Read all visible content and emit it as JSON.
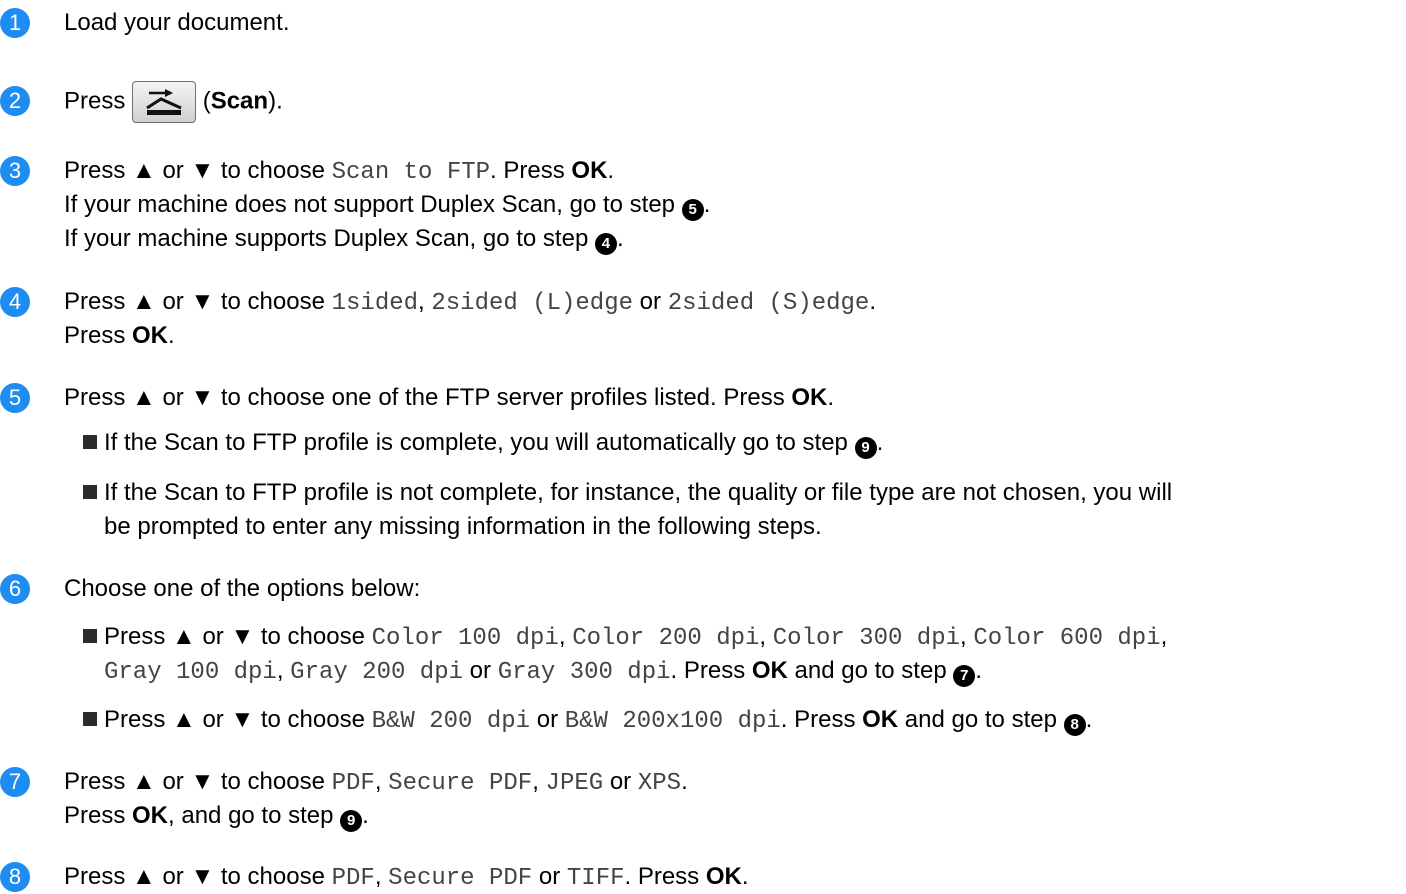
{
  "steps": [
    {
      "num": "1",
      "lines": [
        "Load your document."
      ]
    },
    {
      "num": "2",
      "press": "Press",
      "paren_open": "(",
      "scan_label": "Scan",
      "paren_close": ")."
    },
    {
      "num": "3",
      "a": "Press ▲ or ▼ to choose ",
      "mono": "Scan to FTP",
      "b": ". Press ",
      "ok": "OK",
      "c": ".",
      "l2": "If your machine does not support Duplex Scan, go to step ",
      "l2_ref": "5",
      "l2_end": ".",
      "l3": "If your machine supports Duplex Scan, go to step ",
      "l3_ref": "4",
      "l3_end": "."
    },
    {
      "num": "4",
      "a": "Press ▲ or ▼ to choose ",
      "m1": "1sided",
      "s1": ", ",
      "m2": "2sided (L)edge",
      "s2": " or ",
      "m3": "2sided (S)edge",
      "s3": ".",
      "l2": "Press ",
      "ok": "OK",
      "l2_end": "."
    },
    {
      "num": "5",
      "a": "Press ▲ or ▼ to choose one of the FTP server profiles listed. Press ",
      "ok": "OK",
      "b": ".",
      "bul1": "If the Scan to FTP profile is complete, you will automatically go to step ",
      "bul1_ref": "9",
      "bul1_end": ".",
      "bul2a": "If the Scan to FTP profile is not complete, for instance, the quality or file type are not chosen, you will",
      "bul2b": "be prompted to enter any missing information in the following steps."
    },
    {
      "num": "6",
      "a": "Choose one of the options below:",
      "b1_a": "Press ▲ or ▼ to choose ",
      "b1_m1": "Color 100 dpi",
      "b1_m2": "Color 200 dpi",
      "b1_m3": "Color 300 dpi",
      "b1_m4": "Color 600 dpi",
      "b1_m5": "Gray 100 dpi",
      "b1_m6": "Gray 200 dpi",
      "b1_or": " or ",
      "b1_m7": "Gray 300 dpi",
      "b1_press": ". Press ",
      "b1_ok": "OK",
      "b1_go": " and go to step ",
      "b1_ref": "7",
      "b1_end": ".",
      "b2_a": "Press ▲ or ▼ to choose ",
      "b2_m1": "B&W 200 dpi",
      "b2_or": " or ",
      "b2_m2": "B&W 200x100 dpi",
      "b2_press": ". Press ",
      "b2_ok": "OK",
      "b2_go": " and go to step ",
      "b2_ref": "8",
      "b2_end": "."
    },
    {
      "num": "7",
      "a": "Press ▲ or ▼ to choose ",
      "m1": "PDF",
      "m2": "Secure PDF",
      "m3": "JPEG",
      "or": " or ",
      "m4": "XPS",
      "end": ".",
      "l2": "Press ",
      "ok": "OK",
      "l2_b": ", and go to step ",
      "ref": "9",
      "l2_end": "."
    },
    {
      "num": "8",
      "a": "Press ▲ or ▼ to choose ",
      "m1": "PDF",
      "m2": "Secure PDF",
      "or": " or ",
      "m3": "TIFF",
      "b": ". Press ",
      "ok": "OK",
      "end": "."
    }
  ],
  "comma": ", ",
  "accent_color": "#1e8cf0"
}
